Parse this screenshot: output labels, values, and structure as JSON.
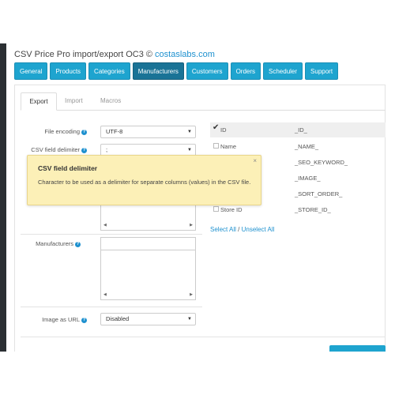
{
  "header": {
    "title_prefix": "CSV Price Pro import/export OC3 © ",
    "title_link": "costaslabs.com"
  },
  "main_tabs": [
    {
      "label": "General"
    },
    {
      "label": "Products"
    },
    {
      "label": "Categories"
    },
    {
      "label": "Manufacturers"
    },
    {
      "label": "Customers"
    },
    {
      "label": "Orders"
    },
    {
      "label": "Scheduler"
    },
    {
      "label": "Support"
    }
  ],
  "sub_tabs": [
    {
      "label": "Export"
    },
    {
      "label": "Import"
    },
    {
      "label": "Macros"
    }
  ],
  "form": {
    "file_encoding": {
      "label": "File encoding",
      "value": "UTF-8"
    },
    "csv_delimiter": {
      "label": "CSV field delimiter",
      "value": ";"
    },
    "manufacturers": {
      "label": "Manufacturers"
    },
    "image_as_url": {
      "label": "Image as URL",
      "value": "Disabled"
    }
  },
  "fields": [
    {
      "name": "ID",
      "value": "_ID_",
      "checked": true
    },
    {
      "name": "Name",
      "value": "_NAME_",
      "checked": false
    },
    {
      "name": "",
      "value": "_SEO_KEYWORD_",
      "checked": false
    },
    {
      "name": "",
      "value": "_IMAGE_",
      "checked": false
    },
    {
      "name": "",
      "value": "_SORT_ORDER_",
      "checked": false
    },
    {
      "name": "Store ID",
      "value": "_STORE_ID_",
      "checked": false
    }
  ],
  "links": {
    "select_all": "Select All",
    "separator": "/",
    "unselect_all": "Unselect All"
  },
  "tooltip": {
    "title": "CSV field delimiter",
    "body": "Character to be used as a delimiter for separate columns (values) in the CSV file.",
    "close": "×"
  },
  "icons": {
    "help": "?",
    "caret": "▼",
    "check": "✔",
    "up": "▲",
    "down": "▼"
  }
}
